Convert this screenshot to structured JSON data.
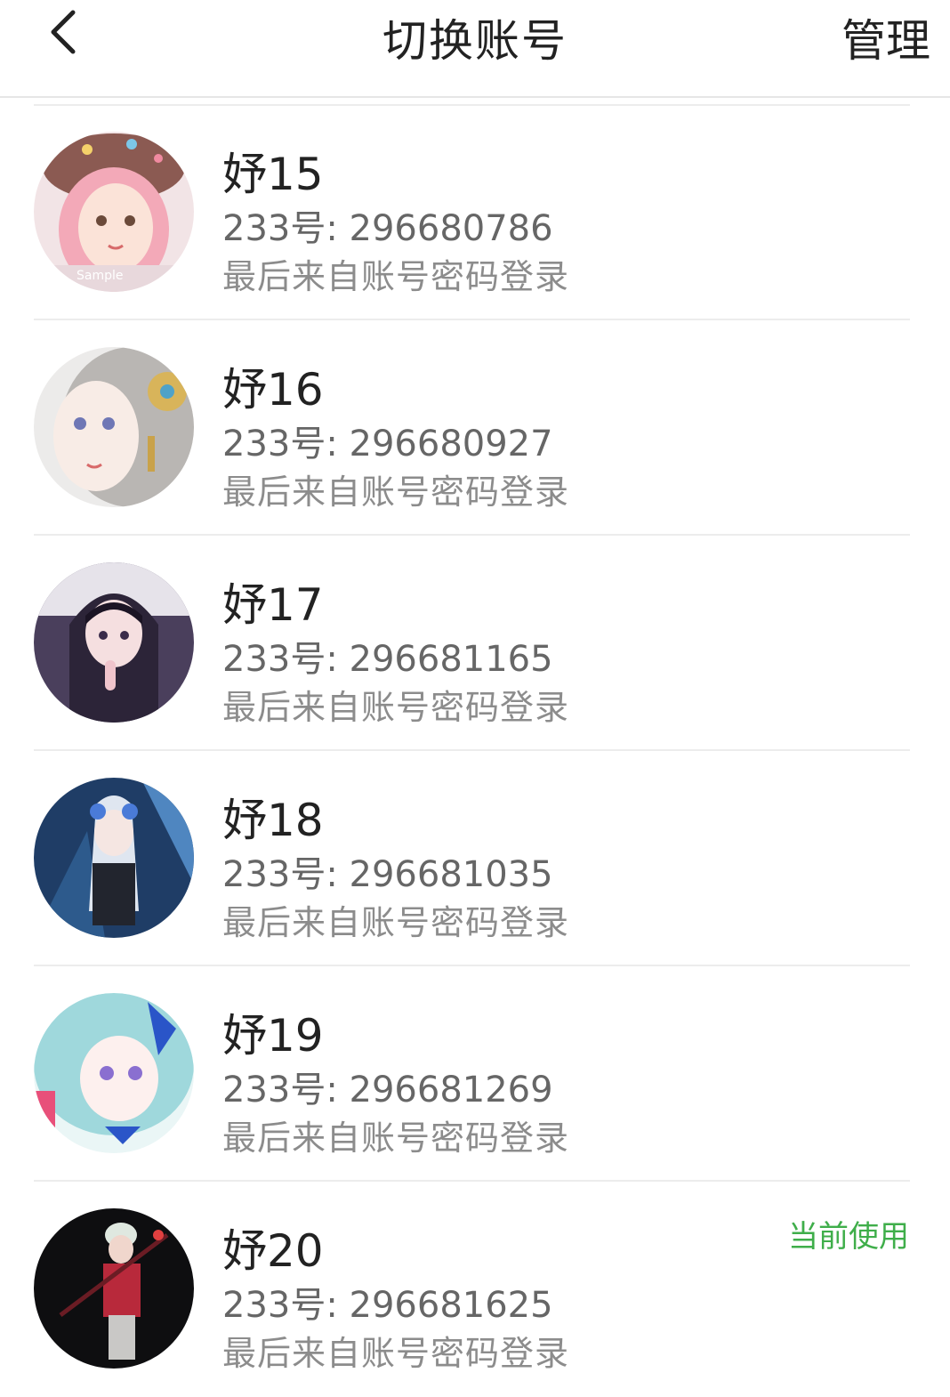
{
  "header": {
    "title": "切换账号",
    "manage_label": "管理"
  },
  "accounts": [
    {
      "name": "妤15",
      "uid": "233号: 296680786",
      "login": "最后来自账号密码登录",
      "current": ""
    },
    {
      "name": "妤16",
      "uid": "233号: 296680927",
      "login": "最后来自账号密码登录",
      "current": ""
    },
    {
      "name": "妤17",
      "uid": "233号: 296681165",
      "login": "最后来自账号密码登录",
      "current": ""
    },
    {
      "name": "妤18",
      "uid": "233号: 296681035",
      "login": "最后来自账号密码登录",
      "current": ""
    },
    {
      "name": "妤19",
      "uid": "233号: 296681269",
      "login": "最后来自账号密码登录",
      "current": ""
    },
    {
      "name": "妤20",
      "uid": "233号: 296681625",
      "login": "最后来自账号密码登录",
      "current": "当前使用"
    }
  ],
  "colors": {
    "current_badge": "#3fae4a",
    "divider": "#ececec"
  }
}
